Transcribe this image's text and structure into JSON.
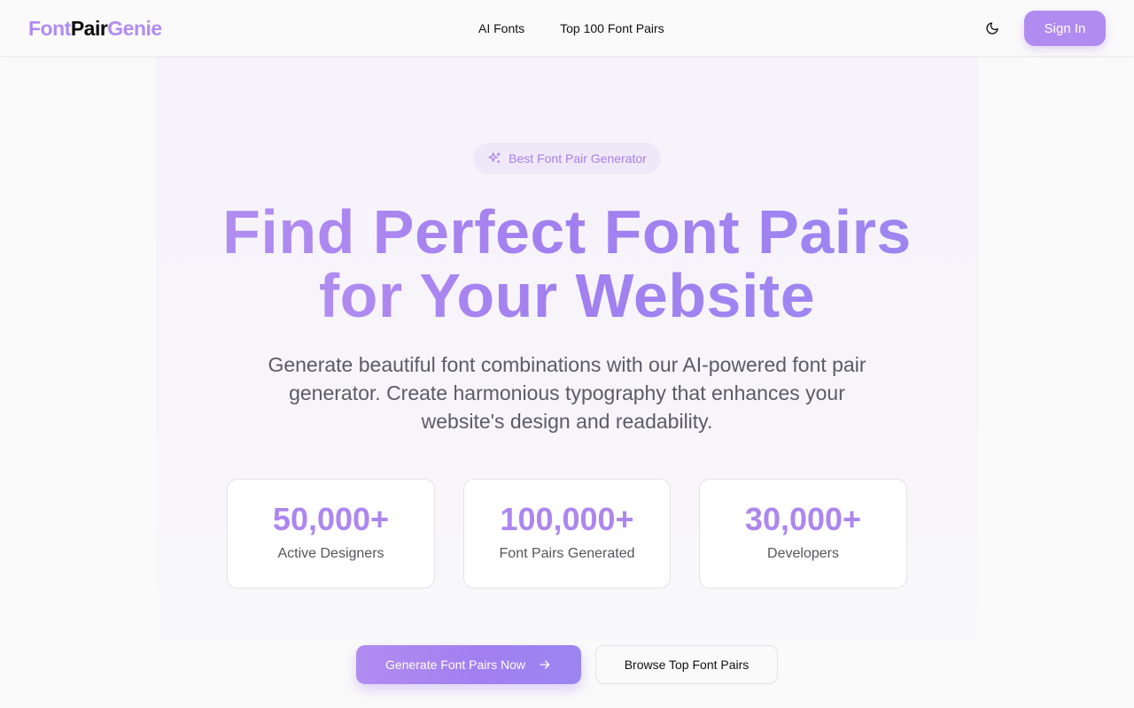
{
  "brand": {
    "part1": "Font",
    "part2": "Pair",
    "part3": "Genie",
    "accent_color": "#b18cf0",
    "dark_color": "#0b0b0b"
  },
  "nav": {
    "links": [
      {
        "label": "AI Fonts"
      },
      {
        "label": "Top 100 Font Pairs"
      }
    ],
    "theme_icon": "moon-icon",
    "signin_label": "Sign In"
  },
  "hero": {
    "badge": {
      "icon": "sparkles-icon",
      "label": "Best Font Pair Generator"
    },
    "headline_line1": "Find Perfect Font Pairs",
    "headline_line2": "for Your Website",
    "subtitle": "Generate beautiful font combinations with our AI-powered font pair generator. Create harmonious typography that enhances your website's design and readability."
  },
  "stats": [
    {
      "value": "50,000+",
      "label": "Active Designers"
    },
    {
      "value": "100,000+",
      "label": "Font Pairs Generated"
    },
    {
      "value": "30,000+",
      "label": "Developers"
    }
  ],
  "cta": {
    "primary_label": "Generate Font Pairs Now",
    "primary_icon": "arrow-right-icon",
    "secondary_label": "Browse Top Font Pairs"
  }
}
